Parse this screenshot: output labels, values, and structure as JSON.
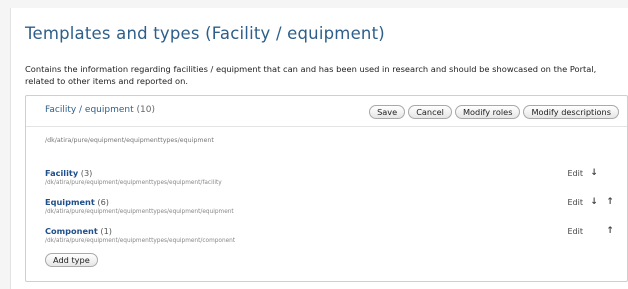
{
  "page": {
    "title": "Templates and types (Facility / equipment)",
    "description": "Contains the information regarding facilities / equipment that can and has been used in research and should be showcased on the Portal, related to other items and reported on."
  },
  "card": {
    "title": "Facility / equipment",
    "count": "(10)",
    "path": "/dk/atira/pure/equipment/equipmenttypes/equipment",
    "buttons": {
      "save": "Save",
      "cancel": "Cancel",
      "modify_roles": "Modify roles",
      "modify_descriptions": "Modify descriptions"
    },
    "add_type_label": "Add type"
  },
  "types": [
    {
      "name": "Facility",
      "count": "(3)",
      "path": "/dk/atira/pure/equipment/equipmenttypes/equipment/facility",
      "edit": "Edit",
      "down": "↓",
      "up": ""
    },
    {
      "name": "Equipment",
      "count": "(6)",
      "path": "/dk/atira/pure/equipment/equipmenttypes/equipment/equipment",
      "edit": "Edit",
      "down": "↓",
      "up": "↑"
    },
    {
      "name": "Component",
      "count": "(1)",
      "path": "/dk/atira/pure/equipment/equipmenttypes/equipment/component",
      "edit": "Edit",
      "down": "",
      "up": "↑"
    }
  ]
}
